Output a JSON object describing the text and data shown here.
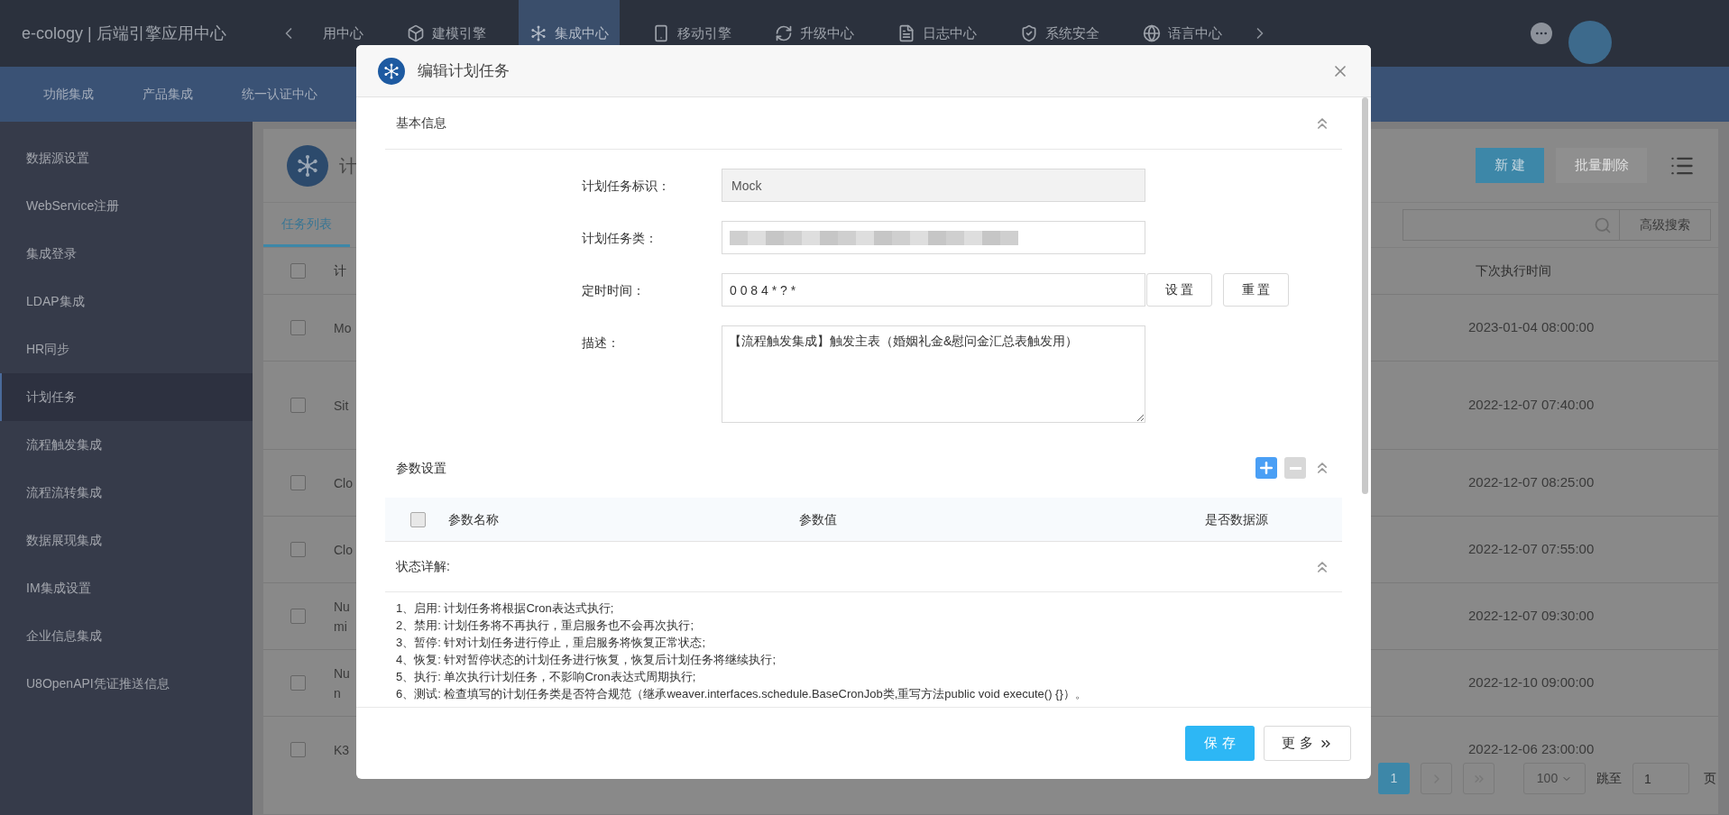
{
  "header": {
    "title": "e-cology | 后端引擎应用中心",
    "nav": [
      {
        "label": "用中心",
        "selected": false
      },
      {
        "label": "建模引擎",
        "selected": false
      },
      {
        "label": "集成中心",
        "selected": true
      },
      {
        "label": "移动引擎",
        "selected": false
      },
      {
        "label": "升级中心",
        "selected": false
      },
      {
        "label": "日志中心",
        "selected": false
      },
      {
        "label": "系统安全",
        "selected": false
      },
      {
        "label": "语言中心",
        "selected": false
      }
    ]
  },
  "subnav": [
    "功能集成",
    "产品集成",
    "统一认证中心"
  ],
  "sidebar": {
    "items": [
      {
        "label": "数据源设置",
        "selected": false
      },
      {
        "label": "WebService注册",
        "selected": false
      },
      {
        "label": "集成登录",
        "selected": false
      },
      {
        "label": "LDAP集成",
        "selected": false
      },
      {
        "label": "HR同步",
        "selected": false
      },
      {
        "label": "计划任务",
        "selected": true
      },
      {
        "label": "流程触发集成",
        "selected": false
      },
      {
        "label": "流程流转集成",
        "selected": false
      },
      {
        "label": "数据展现集成",
        "selected": false
      },
      {
        "label": "IM集成设置",
        "selected": false
      },
      {
        "label": "企业信息集成",
        "selected": false
      },
      {
        "label": "U8OpenAPI凭证推送信息",
        "selected": false
      }
    ]
  },
  "page": {
    "title": "计",
    "buttons": [
      {
        "label": "新 建",
        "disabled": false
      },
      {
        "label": "批量删除",
        "disabled": true
      }
    ],
    "tabs": [
      {
        "label": "任务列表",
        "selected": true
      }
    ],
    "advanced_search": "高级搜索",
    "table": {
      "columns": [
        "计",
        "下次执行时间"
      ],
      "all_checked": false,
      "rows": [
        {
          "checked": false,
          "name_lines": [
            "Mo"
          ],
          "next_run": "2023-01-04 08:00:00"
        },
        {
          "checked": false,
          "name_lines": [
            "Sit"
          ],
          "next_run": "2022-12-07 07:40:00"
        },
        {
          "checked": false,
          "name_lines": [
            "Clo"
          ],
          "next_run": "2022-12-07 08:25:00"
        },
        {
          "checked": false,
          "name_lines": [
            "Clo"
          ],
          "next_run": "2022-12-07 07:55:00"
        },
        {
          "checked": false,
          "name_lines": [
            "Nu",
            "mi"
          ],
          "next_run": "2022-12-07 09:30:00"
        },
        {
          "checked": false,
          "name_lines": [
            "Nu",
            "n"
          ],
          "next_run": "2022-12-10 09:00:00"
        },
        {
          "checked": false,
          "name_lines": [
            "K3"
          ],
          "next_run": "2022-12-06 23:00:00"
        }
      ]
    },
    "pagination": {
      "pages": [
        {
          "label": "1",
          "selected": true
        }
      ],
      "page_size": "100",
      "jump_label": "跳至",
      "jump_value": "1",
      "page_suffix": "页"
    }
  },
  "dialog": {
    "title": "编辑计划任务",
    "basic": {
      "title": "基本信息",
      "fields": [
        {
          "kind": "text",
          "label": "计划任务标识：",
          "value": "Mock",
          "disabled": true
        },
        {
          "kind": "redacted",
          "label": "计划任务类："
        },
        {
          "kind": "cron",
          "label": "定时时间：",
          "value": "0 0 8 4 * ? *",
          "buttons": [
            "设 置",
            "重 置"
          ]
        },
        {
          "kind": "textarea",
          "label": "描述：",
          "value": "【流程触发集成】触发主表（婚姻礼金&慰问金汇总表触发用）"
        }
      ]
    },
    "params": {
      "title": "参数设置",
      "all_checked": false,
      "columns": [
        "参数名称",
        "参数值",
        "是否数据源"
      ]
    },
    "status_help": {
      "title": "状态详解:",
      "lines": [
        "1、启用: 计划任务将根据Cron表达式执行;",
        "2、禁用: 计划任务将不再执行，重启服务也不会再次执行;",
        "3、暂停: 针对计划任务进行停止，重启服务将恢复正常状态;",
        "4、恢复: 针对暂停状态的计划任务进行恢复，恢复后计划任务将继续执行;",
        "5、执行: 单次执行计划任务，不影响Cron表达式周期执行;",
        "6、测试: 检查填写的计划任务类是否符合规范（继承weaver.interfaces.schedule.BaseCronJob类,重写方法public void execute() {}）。"
      ]
    },
    "footer_buttons": [
      {
        "label": "保 存",
        "primary": true
      },
      {
        "label": "更 多",
        "primary": false
      }
    ]
  }
}
